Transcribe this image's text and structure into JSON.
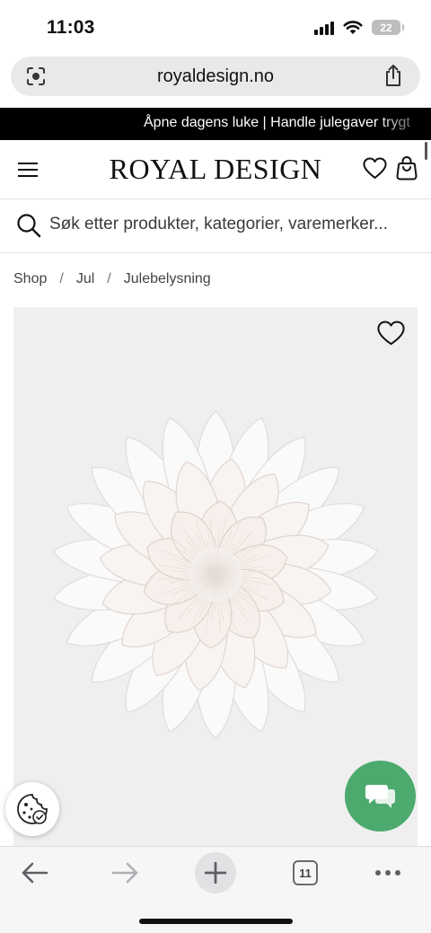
{
  "status_bar": {
    "time": "11:03",
    "battery": "22"
  },
  "browser": {
    "url": "royaldesign.no",
    "tab_count": "11"
  },
  "announcement": {
    "text": "Åpne dagens luke | Handle julegaver trygt"
  },
  "header": {
    "logo": "ROYAL DESIGN"
  },
  "search": {
    "placeholder": "Søk etter produkter, kategorier, varemerker..."
  },
  "breadcrumb": {
    "items": [
      "Shop",
      "Jul",
      "Julebelysning"
    ],
    "separator": "/"
  },
  "icons": {
    "url_left": "lens-icon",
    "share": "share-icon",
    "menu": "hamburger-menu-icon",
    "wishlist": "heart-icon",
    "cart": "bag-icon",
    "search": "search-icon",
    "product_wishlist": "heart-outline-icon",
    "cookie": "cookie-icon",
    "chat": "chat-bubbles-icon",
    "back": "arrow-left-icon",
    "forward": "arrow-right-icon",
    "new_tab": "plus-icon",
    "more": "more-dots-icon"
  },
  "colors": {
    "announcement_bg": "#000000",
    "chat_button": "#4daa6e",
    "product_bg": "#efefef"
  }
}
